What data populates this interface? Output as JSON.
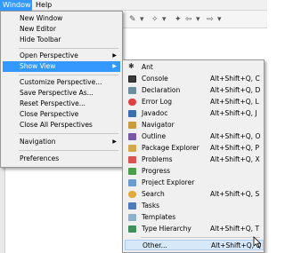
{
  "menubar": {
    "window": "Window",
    "help": "Help"
  },
  "window_menu": {
    "items": [
      {
        "label": "New Window"
      },
      {
        "label": "New Editor"
      },
      {
        "label": "Hide Toolbar"
      },
      {
        "label": "Open Perspective"
      },
      {
        "label": "Show View"
      },
      {
        "label": "Customize Perspective..."
      },
      {
        "label": "Save Perspective As..."
      },
      {
        "label": "Reset Perspective..."
      },
      {
        "label": "Close Perspective"
      },
      {
        "label": "Close All Perspectives"
      },
      {
        "label": "Navigation"
      },
      {
        "label": "Preferences"
      }
    ]
  },
  "show_view_menu": {
    "items": [
      {
        "label": "Ant",
        "shortcut": "",
        "icon": "ant-icon"
      },
      {
        "label": "Console",
        "shortcut": "Alt+Shift+Q, C",
        "icon": "console-icon"
      },
      {
        "label": "Declaration",
        "shortcut": "Alt+Shift+Q, D",
        "icon": "declaration-icon"
      },
      {
        "label": "Error Log",
        "shortcut": "Alt+Shift+Q, L",
        "icon": "error-log-icon"
      },
      {
        "label": "Javadoc",
        "shortcut": "Alt+Shift+Q, J",
        "icon": "javadoc-icon"
      },
      {
        "label": "Navigator",
        "shortcut": "",
        "icon": "navigator-icon"
      },
      {
        "label": "Outline",
        "shortcut": "Alt+Shift+Q, O",
        "icon": "outline-icon"
      },
      {
        "label": "Package Explorer",
        "shortcut": "Alt+Shift+Q, P",
        "icon": "package-explorer-icon"
      },
      {
        "label": "Problems",
        "shortcut": "Alt+Shift+Q, X",
        "icon": "problems-icon"
      },
      {
        "label": "Progress",
        "shortcut": "",
        "icon": "progress-icon"
      },
      {
        "label": "Project Explorer",
        "shortcut": "",
        "icon": "project-explorer-icon"
      },
      {
        "label": "Search",
        "shortcut": "Alt+Shift+Q, S",
        "icon": "search-icon"
      },
      {
        "label": "Tasks",
        "shortcut": "",
        "icon": "tasks-icon"
      },
      {
        "label": "Templates",
        "shortcut": "",
        "icon": "templates-icon"
      },
      {
        "label": "Type Hierarchy",
        "shortcut": "Alt+Shift+Q, T",
        "icon": "type-hierarchy-icon"
      },
      {
        "label": "Other...",
        "shortcut": "Alt+Shift+Q, Q",
        "icon": ""
      }
    ]
  },
  "colors": {
    "highlight": "#3399ff",
    "menu_bg": "#f0f0f0"
  }
}
